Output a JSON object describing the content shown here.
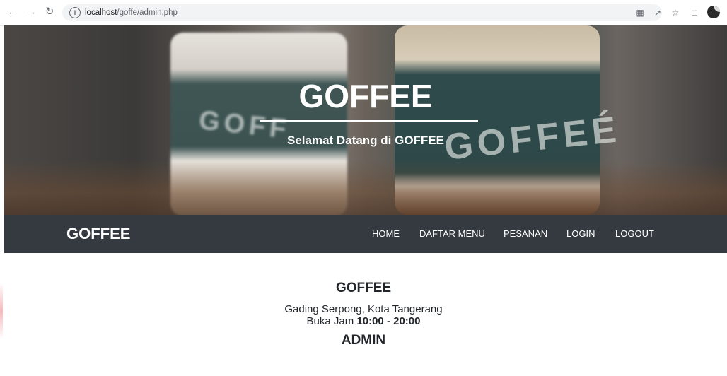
{
  "browser": {
    "url_host": "localhost",
    "url_path": "/goffe/admin.php",
    "back_icon": "arrow-left-icon",
    "forward_icon": "arrow-right-icon",
    "reload_icon": "reload-icon",
    "info_icon": "info-icon"
  },
  "hero": {
    "title": "GOFFEE",
    "subtitle": "Selamat Datang di GOFFEE",
    "cup_logo_left": "GOFF",
    "cup_logo_right": "GOFFEÉ"
  },
  "navbar": {
    "brand": "GOFFEE",
    "links": [
      "HOME",
      "DAFTAR MENU",
      "PESANAN",
      "LOGIN",
      "LOGOUT"
    ],
    "background": "#343a40"
  },
  "content": {
    "title": "GOFFEE",
    "address": "Gading Serpong, Kota Tangerang",
    "hours_prefix": "Buka Jam",
    "hours_value": "10:00 - 20:00",
    "role": "ADMIN"
  }
}
